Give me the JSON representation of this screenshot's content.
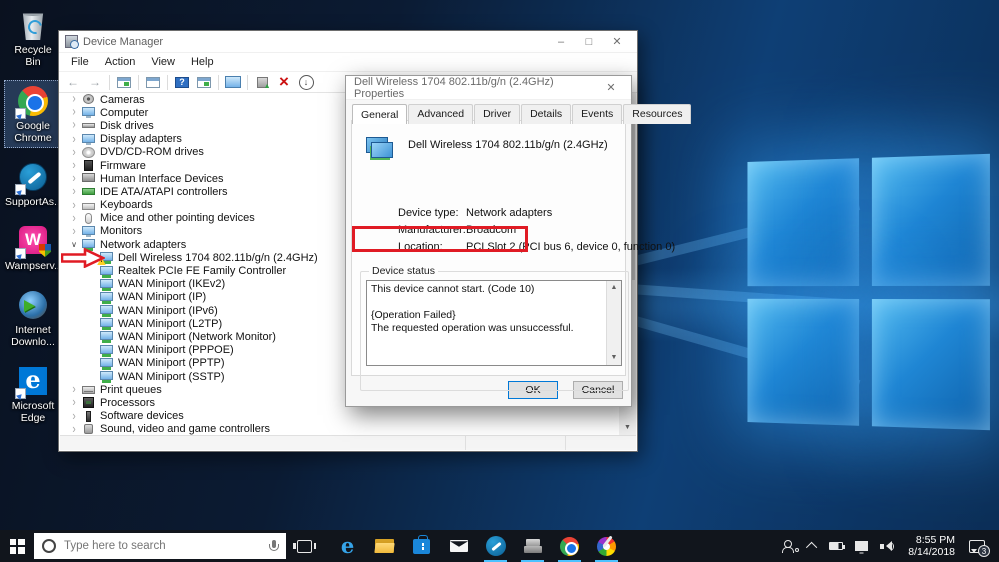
{
  "annotation_color": "#e01b24",
  "desktop": {
    "icons": [
      {
        "icon": "recycle-bin",
        "label": "Recycle Bin",
        "selected": false,
        "shortcut": false
      },
      {
        "icon": "chrome",
        "label": "Google Chrome",
        "selected": true,
        "shortcut": true
      },
      {
        "icon": "supportassist",
        "label": "SupportAs...",
        "selected": false,
        "shortcut": true
      },
      {
        "icon": "wampserver",
        "label": "Wampserv...",
        "selected": false,
        "shortcut": true
      },
      {
        "icon": "idm",
        "label": "Internet Downlo...",
        "selected": false,
        "shortcut": false
      },
      {
        "icon": "edge",
        "label": "Microsoft Edge",
        "selected": false,
        "shortcut": true
      }
    ]
  },
  "device_manager": {
    "title": "Device Manager",
    "menu": [
      {
        "label": "File"
      },
      {
        "label": "Action"
      },
      {
        "label": "View"
      },
      {
        "label": "Help"
      }
    ],
    "toolbar_icons": [
      "back",
      "forward",
      "console-tree",
      "properties-window",
      "help",
      "export-list",
      "computer",
      "update-driver",
      "uninstall",
      "scan-hardware-changes"
    ],
    "tree": [
      {
        "label": "Cameras",
        "icon": "camera",
        "state": "collapsed",
        "child": false,
        "warning": false
      },
      {
        "label": "Computer",
        "icon": "computer",
        "state": "collapsed",
        "child": false,
        "warning": false
      },
      {
        "label": "Disk drives",
        "icon": "disk",
        "state": "collapsed",
        "child": false,
        "warning": false
      },
      {
        "label": "Display adapters",
        "icon": "display",
        "state": "collapsed",
        "child": false,
        "warning": false
      },
      {
        "label": "DVD/CD-ROM drives",
        "icon": "dvd",
        "state": "collapsed",
        "child": false,
        "warning": false
      },
      {
        "label": "Firmware",
        "icon": "firmware",
        "state": "collapsed",
        "child": false,
        "warning": false
      },
      {
        "label": "Human Interface Devices",
        "icon": "hid",
        "state": "collapsed",
        "child": false,
        "warning": false
      },
      {
        "label": "IDE ATA/ATAPI controllers",
        "icon": "ide",
        "state": "collapsed",
        "child": false,
        "warning": false
      },
      {
        "label": "Keyboards",
        "icon": "keyboard",
        "state": "collapsed",
        "child": false,
        "warning": false
      },
      {
        "label": "Mice and other pointing devices",
        "icon": "mouse",
        "state": "collapsed",
        "child": false,
        "warning": false
      },
      {
        "label": "Monitors",
        "icon": "monitor",
        "state": "collapsed",
        "child": false,
        "warning": false
      },
      {
        "label": "Network adapters",
        "icon": "net",
        "state": "expanded",
        "child": false,
        "warning": false
      },
      {
        "label": "Dell Wireless 1704 802.11b/g/n (2.4GHz)",
        "icon": "net",
        "state": "none",
        "child": true,
        "warning": true
      },
      {
        "label": "Realtek PCIe FE Family Controller",
        "icon": "net",
        "state": "none",
        "child": true,
        "warning": false
      },
      {
        "label": "WAN Miniport (IKEv2)",
        "icon": "net",
        "state": "none",
        "child": true,
        "warning": false
      },
      {
        "label": "WAN Miniport (IP)",
        "icon": "net",
        "state": "none",
        "child": true,
        "warning": false
      },
      {
        "label": "WAN Miniport (IPv6)",
        "icon": "net",
        "state": "none",
        "child": true,
        "warning": false
      },
      {
        "label": "WAN Miniport (L2TP)",
        "icon": "net",
        "state": "none",
        "child": true,
        "warning": false
      },
      {
        "label": "WAN Miniport (Network Monitor)",
        "icon": "net",
        "state": "none",
        "child": true,
        "warning": false
      },
      {
        "label": "WAN Miniport (PPPOE)",
        "icon": "net",
        "state": "none",
        "child": true,
        "warning": false
      },
      {
        "label": "WAN Miniport (PPTP)",
        "icon": "net",
        "state": "none",
        "child": true,
        "warning": false
      },
      {
        "label": "WAN Miniport (SSTP)",
        "icon": "net",
        "state": "none",
        "child": true,
        "warning": false
      },
      {
        "label": "Print queues",
        "icon": "print",
        "state": "collapsed",
        "child": false,
        "warning": false
      },
      {
        "label": "Processors",
        "icon": "cpu",
        "state": "collapsed",
        "child": false,
        "warning": false
      },
      {
        "label": "Software devices",
        "icon": "software",
        "state": "collapsed",
        "child": false,
        "warning": false
      },
      {
        "label": "Sound, video and game controllers",
        "icon": "sound",
        "state": "collapsed",
        "child": false,
        "warning": false
      }
    ]
  },
  "dialog": {
    "title": "Dell Wireless 1704 802.11b/g/n (2.4GHz) Properties",
    "tabs": [
      {
        "label": "General",
        "active": true
      },
      {
        "label": "Advanced",
        "active": false
      },
      {
        "label": "Driver",
        "active": false
      },
      {
        "label": "Details",
        "active": false
      },
      {
        "label": "Events",
        "active": false
      },
      {
        "label": "Resources",
        "active": false
      }
    ],
    "device_name": "Dell Wireless 1704 802.11b/g/n (2.4GHz)",
    "fields": [
      {
        "label": "Device type:",
        "value": "Network adapters"
      },
      {
        "label": "Manufacturer:",
        "value": "Broadcom"
      },
      {
        "label": "Location:",
        "value": "PCI Slot 2 (PCI bus 6, device 0, function 0)"
      }
    ],
    "status_group_label": "Device status",
    "status_lines": [
      {
        "text": "This device cannot start. (Code 10)"
      },
      {
        "text": ""
      },
      {
        "text": "{Operation Failed}"
      },
      {
        "text": "The requested operation was unsuccessful."
      }
    ],
    "ok_label": "OK",
    "cancel_label": "Cancel"
  },
  "taskbar": {
    "search_placeholder": "Type here to search",
    "pinned": [
      {
        "icon": "edge",
        "active": false
      },
      {
        "icon": "explorer",
        "active": false
      },
      {
        "icon": "store",
        "active": false
      },
      {
        "icon": "mail",
        "active": false
      },
      {
        "icon": "supportassist",
        "active": true
      },
      {
        "icon": "device",
        "active": true
      },
      {
        "icon": "chrome",
        "active": true
      },
      {
        "icon": "paint",
        "active": true
      }
    ],
    "tray_time": "8:55 PM",
    "tray_date": "8/14/2018",
    "notification_count": "3"
  }
}
